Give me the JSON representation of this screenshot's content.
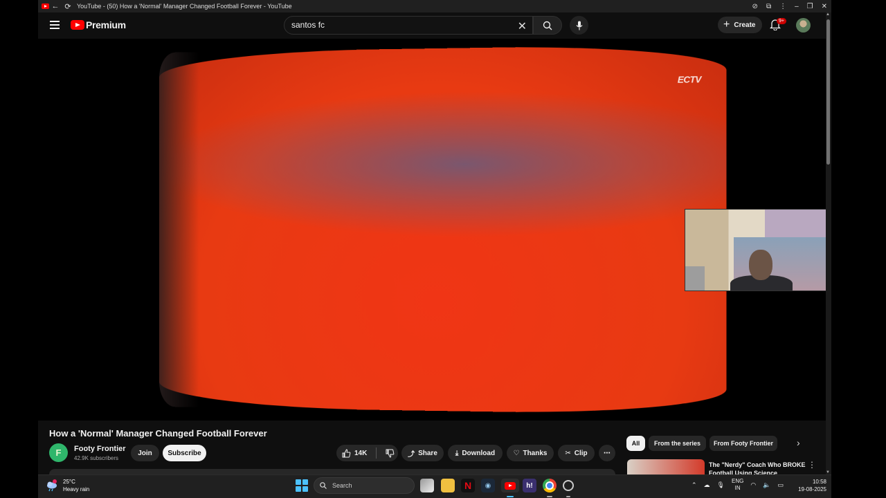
{
  "browser": {
    "title": "YouTube - (50) How a 'Normal' Manager Changed Football Forever - YouTube"
  },
  "masthead": {
    "logo_text": "Premium",
    "search_value": "santos fc",
    "create_label": "Create",
    "notification_badge": "9+"
  },
  "player": {
    "broadcast_logo": "ECTV"
  },
  "video": {
    "title": "How a 'Normal' Manager Changed Football Forever",
    "channel_name": "Footy Frontier",
    "channel_initial": "F",
    "subscribers": "42.9K subscribers",
    "join_label": "Join",
    "subscribe_label": "Subscribe",
    "likes": "14K",
    "share_label": "Share",
    "download_label": "Download",
    "thanks_label": "Thanks",
    "clip_label": "Clip"
  },
  "sidebar": {
    "chips": [
      "All",
      "From the series",
      "From Footy Frontier"
    ],
    "recommendation_title": "The \"Nerdy\" Coach Who BROKE Football Using Science"
  },
  "taskbar": {
    "temperature": "25°C",
    "weather": "Heavy rain",
    "search_label": "Search",
    "lang_top": "ENG",
    "lang_bottom": "IN",
    "time": "10:58",
    "date": "19-08-2025"
  },
  "colors": {
    "youtube_red": "#ff0000",
    "background": "#0f0f0f",
    "chip_active": "#f1f1f1",
    "chip_bg": "#272727",
    "channel_avatar": "#2fb66b"
  }
}
